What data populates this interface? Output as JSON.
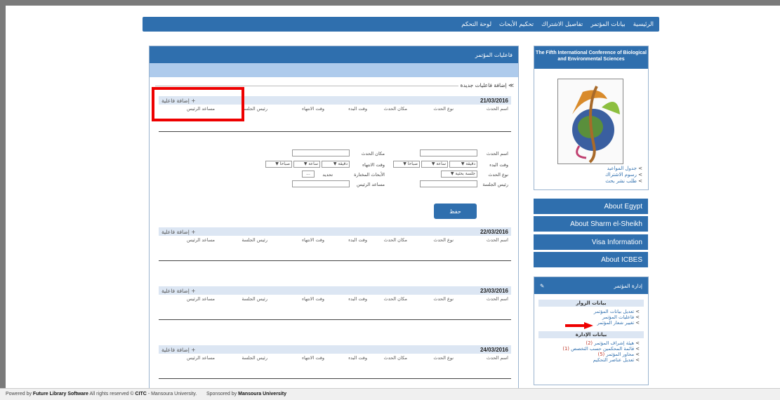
{
  "nav": {
    "items": [
      "الرئيسية",
      "بيانات المؤتمر",
      "تفاصيل الاشتراك",
      "تحكيم الأبحاث",
      "لوحة التحكم"
    ]
  },
  "main": {
    "title": "فاعليات المؤتمر",
    "new_label": "إضافة فاعليات جديدة",
    "add_event": "+ إضافة فاعلية",
    "columns": [
      "اسم الحدث",
      "نوع الحدث",
      "مكان الحدث",
      "وقت البدء",
      "وقت الانتهاء",
      "رئيس الجلسة",
      "مساعد الرئيس"
    ],
    "days": [
      "21/03/2016",
      "22/03/2016",
      "23/03/2016",
      "24/03/2016"
    ]
  },
  "form": {
    "event_name": "اسم الحدث",
    "event_place": "مكان الحدث",
    "start_time": "وقت البدء",
    "end_time": "وقت الانتهاء",
    "event_type": "نوع الحدث",
    "chosen_papers": "الأبحاث المختارة",
    "select": "تحديد",
    "session_chair": "رئيس الجلسة",
    "chair_assistant": "مساعد الرئيس",
    "minute": "دقيقة",
    "hour": "ساعة",
    "am": "صباحا",
    "type_value": "جلسة بحثية",
    "dots": "...",
    "save": "حفظ"
  },
  "sidebar": {
    "conf_title": "The Fifth International Conference of Biological and Environmental Sciences",
    "links": [
      "جدول المواعيد",
      "رسوم الاشتراك",
      "طلب نشر بحث"
    ],
    "buttons": [
      "About Egypt",
      "About Sharm el-Sheikh",
      "Visa Information",
      "About ICBES"
    ],
    "admin_title": "إدارة المؤتمر",
    "group1_title": "بيانات الزوار",
    "group1": [
      "تعديل بيانات المؤتمر",
      "فاعليات المؤتمر",
      "تغيير شعار المؤتمر"
    ],
    "group2_title": "بيانات الإدارة",
    "group2": [
      {
        "label": "هيئة إشراف المؤتمر",
        "count": "(2)"
      },
      {
        "label": "قائمة المحكمين حسب التخصص",
        "count": "(1)"
      },
      {
        "label": "محاور المؤتمر",
        "count": "(5)"
      },
      {
        "label": "تعديل عناصر التحكيم",
        "count": ""
      }
    ]
  },
  "footer": {
    "powered": "Powered by",
    "software": "Future Library Software",
    "rights": "All rights reserved ©",
    "citc": "CITC",
    "univ": "- Mansoura University.",
    "sponsored": "Sponsored by",
    "sponsor": "Mansoura University"
  },
  "colors": {
    "primary": "#2f6fae",
    "light": "#dce6f3",
    "highlight": "#e00000"
  }
}
